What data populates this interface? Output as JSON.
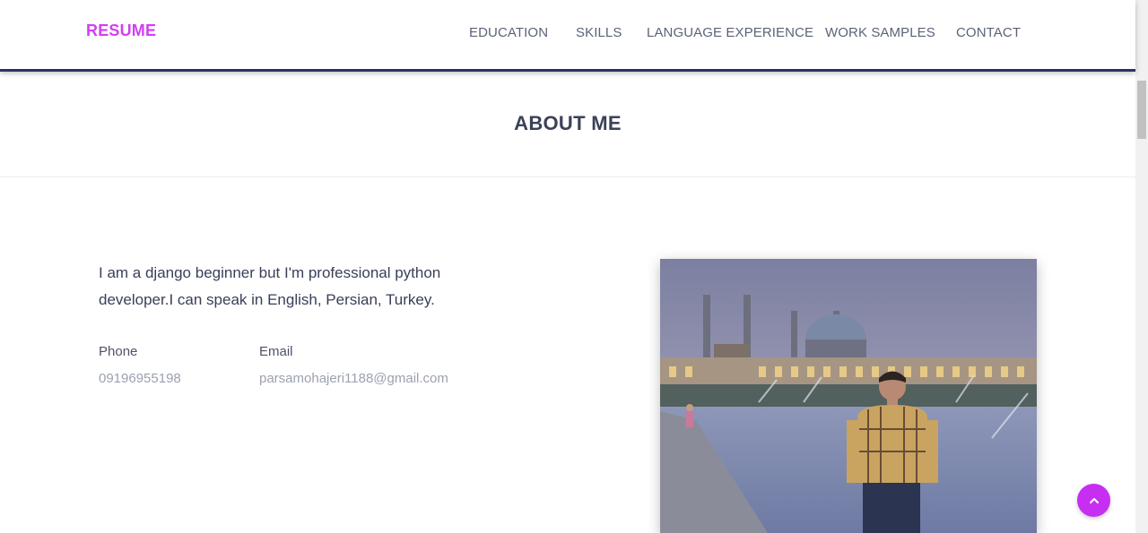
{
  "header": {
    "logo": "RESUME",
    "nav": [
      {
        "label": "EDUCATION"
      },
      {
        "label": "SKILLS"
      },
      {
        "label": "LANGUAGE EXPERIENCE"
      },
      {
        "label": "WORK SAMPLES"
      },
      {
        "label": "CONTACT"
      }
    ]
  },
  "about": {
    "title": "ABOUT ME",
    "line1": "I am a django beginner but I'm professional python",
    "line2": "developer.I can speak in English, Persian, Turkey.",
    "phone_label": "Phone",
    "phone_value": "09196955198",
    "email_label": "Email",
    "email_value": "parsamohajeri1188@gmail.com"
  },
  "icons": {
    "scroll_top": "chevron-up-icon"
  },
  "colors": {
    "brand": "#d23ff2",
    "scroll_button": "#c62ff2",
    "header_border": "#2b3364",
    "heading": "#3b4258",
    "muted": "#9da1b0"
  }
}
